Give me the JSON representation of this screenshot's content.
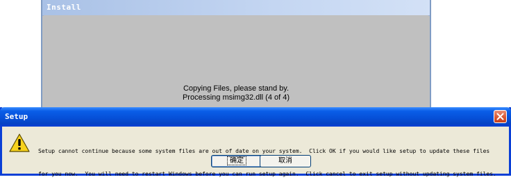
{
  "install_window": {
    "title": "Install",
    "status_line1": "Copying Files, please stand by.",
    "status_line2": "Processing msimg32.dll (4 of 4)"
  },
  "setup_dialog": {
    "title": "Setup",
    "icon": "warning-icon",
    "message_line1": "Setup cannot continue because some system files are out of date on your system.  Click OK if you would like setup to update these files",
    "message_line2": "for you now.  You will need to restart Windows before you can run setup again.  Click cancel to exit setup without updating system files.",
    "ok_label": "确定",
    "cancel_label": "取消"
  },
  "colors": {
    "dialog_titlebar": "#0a5ee8",
    "dialog_face": "#ece9d8",
    "install_face": "#c0c0c0"
  }
}
